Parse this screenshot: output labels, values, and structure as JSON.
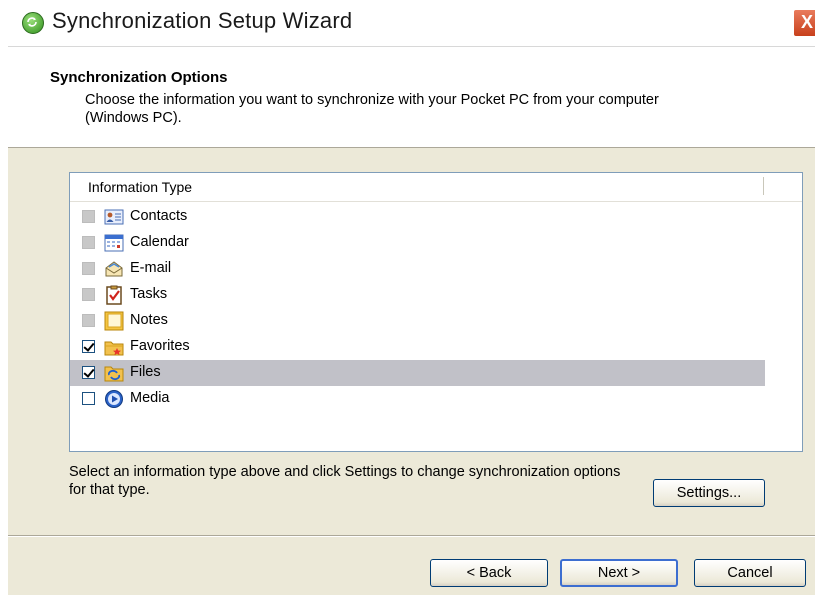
{
  "window": {
    "title": "Synchronization Setup Wizard",
    "close_label": "X"
  },
  "header": {
    "title": "Synchronization Options",
    "description": "Choose the information you want to synchronize with your Pocket PC from your computer (Windows PC)."
  },
  "list": {
    "column_header": "Information Type",
    "items": [
      {
        "label": "Contacts",
        "state": "disabled",
        "icon": "contacts-icon"
      },
      {
        "label": "Calendar",
        "state": "disabled",
        "icon": "calendar-icon"
      },
      {
        "label": "E-mail",
        "state": "disabled",
        "icon": "email-icon"
      },
      {
        "label": "Tasks",
        "state": "disabled",
        "icon": "tasks-icon"
      },
      {
        "label": "Notes",
        "state": "disabled",
        "icon": "notes-icon"
      },
      {
        "label": "Favorites",
        "state": "checked",
        "icon": "favorites-icon"
      },
      {
        "label": "Files",
        "state": "checked",
        "icon": "files-icon",
        "selected": true
      },
      {
        "label": "Media",
        "state": "unchecked",
        "icon": "media-icon"
      }
    ]
  },
  "info_text": "Select an information type above and click Settings to change synchronization options for that type.",
  "buttons": {
    "settings": "Settings...",
    "back": "< Back",
    "next": "Next >",
    "cancel": "Cancel"
  },
  "colors": {
    "dialog_bg": "#ece9d8",
    "selection_bg": "#c1c1c8",
    "border_blue": "#7f9db9"
  }
}
